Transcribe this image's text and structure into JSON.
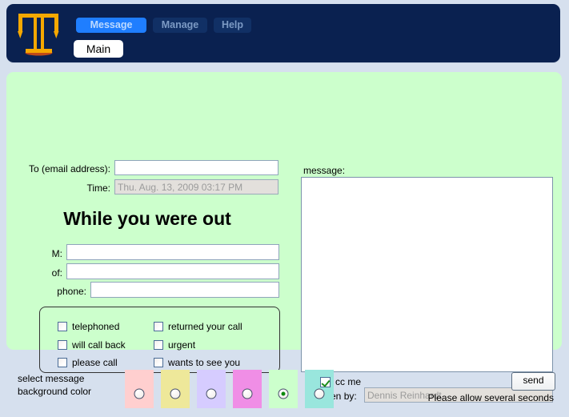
{
  "header": {
    "logo_name": "torii-t-logo",
    "nav": [
      {
        "label": "Message",
        "state": "active"
      },
      {
        "label": "Manage",
        "state": "inactive"
      },
      {
        "label": "Help",
        "state": "inactive"
      }
    ],
    "subnav": {
      "label": "Main",
      "state": "active"
    },
    "colors": {
      "bar_background": "#0a2150",
      "active_button_bg": "#1f7eff",
      "active_button_text": "#bcd9ff",
      "inactive_button_bg": "#113065",
      "inactive_button_text": "#7c9ac4",
      "logo_gold": "#f5a800"
    }
  },
  "form": {
    "panel_background": "#ccffcc",
    "to": {
      "label": "To (email address):",
      "value": "",
      "placeholder": ""
    },
    "time": {
      "label": "Time:",
      "value": "Thu. Aug. 13, 2009 03:17 PM",
      "disabled": true
    },
    "title": "While you were out",
    "m": {
      "label": "M:",
      "value": ""
    },
    "of": {
      "label": "of:",
      "value": ""
    },
    "phone": {
      "label": "phone:",
      "value": ""
    },
    "checkboxes": [
      {
        "label": "telephoned",
        "checked": false
      },
      {
        "label": "returned your call",
        "checked": false
      },
      {
        "label": "will call back",
        "checked": false
      },
      {
        "label": "urgent",
        "checked": false
      },
      {
        "label": "please call",
        "checked": false
      },
      {
        "label": "wants to see you",
        "checked": false
      }
    ],
    "message": {
      "label": "message:",
      "value": "",
      "placeholder": ""
    },
    "taken_by": {
      "label": "taken by:",
      "value": "Dennis Reinhardt",
      "disabled": true
    }
  },
  "footer": {
    "bgcolor_label_line1": "select message",
    "bgcolor_label_line2": "background color",
    "swatches": [
      {
        "name": "pink",
        "color": "#ffcfcf",
        "selected": false
      },
      {
        "name": "yellow",
        "color": "#eee89a",
        "selected": false
      },
      {
        "name": "lavender",
        "color": "#d6ccff",
        "selected": false
      },
      {
        "name": "magenta",
        "color": "#f08ee6",
        "selected": false
      },
      {
        "name": "green",
        "color": "#ccffcc",
        "selected": true
      },
      {
        "name": "cyan",
        "color": "#99e6dd",
        "selected": false
      }
    ],
    "cc_me": {
      "label": "cc me",
      "checked": true
    },
    "send_button": "send",
    "send_note": "Please allow several seconds",
    "page_background": "#d6e0ee"
  }
}
